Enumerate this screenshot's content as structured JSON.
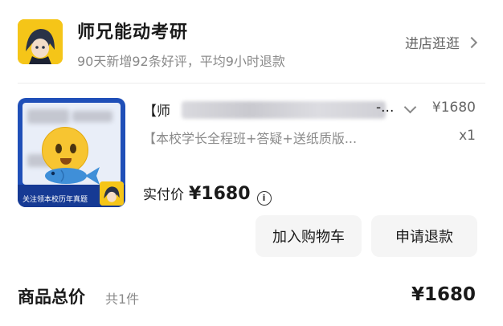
{
  "shop": {
    "name": "师兄能动考研",
    "subtitle": "90天新增92条好评，平均9小时退款",
    "enter_store": "进店逛逛"
  },
  "product": {
    "title_start": "【师",
    "title_end": "-...",
    "sku": "【本校学长全程班+答疑+送纸质版...",
    "unit_price": "¥1680",
    "quantity": "x1",
    "thumbnail_banner": "关注领本校历年真题"
  },
  "payment": {
    "paid_label": "实付价",
    "paid_amount": "¥1680"
  },
  "actions": {
    "add_to_cart": "加入购物车",
    "request_refund": "申请退款"
  },
  "summary": {
    "total_label": "商品总价",
    "total_count": "共1件",
    "total_amount": "¥1680"
  },
  "icons": {
    "enter_store": "chevron-right-icon",
    "expand": "chevron-down-icon",
    "info": "info-icon"
  }
}
